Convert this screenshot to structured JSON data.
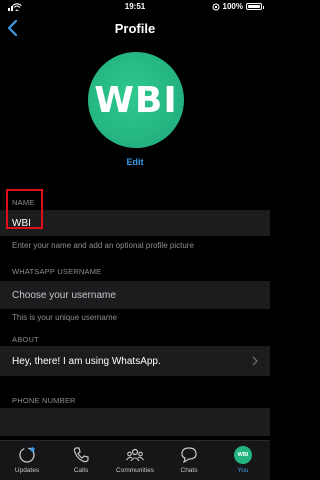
{
  "status": {
    "time": "19:51",
    "battery": "100%"
  },
  "nav": {
    "title": "Profile"
  },
  "profile": {
    "avatar_text": "WBI",
    "edit_label": "Edit"
  },
  "name": {
    "section_label": "NAME",
    "value": "WBI",
    "help": "Enter your name and add an optional profile picture"
  },
  "username": {
    "section_label": "WHATSAPP USERNAME",
    "placeholder": "Choose your username",
    "help": "This is your unique username"
  },
  "about": {
    "section_label": "ABOUT",
    "value": "Hey, there! I am using WhatsApp."
  },
  "phone": {
    "section_label": "PHONE NUMBER"
  },
  "tabs": [
    {
      "label": "Updates",
      "icon": "updates-icon"
    },
    {
      "label": "Calls",
      "icon": "phone-icon"
    },
    {
      "label": "Communities",
      "icon": "communities-icon"
    },
    {
      "label": "Chats",
      "icon": "chats-icon"
    },
    {
      "label": "You",
      "icon": "avatar",
      "avatar_text": "WBI",
      "active": true
    }
  ],
  "colors": {
    "accent": "#3b9ae8",
    "avatar": "#25b581",
    "highlight_box": "#e0101a"
  }
}
